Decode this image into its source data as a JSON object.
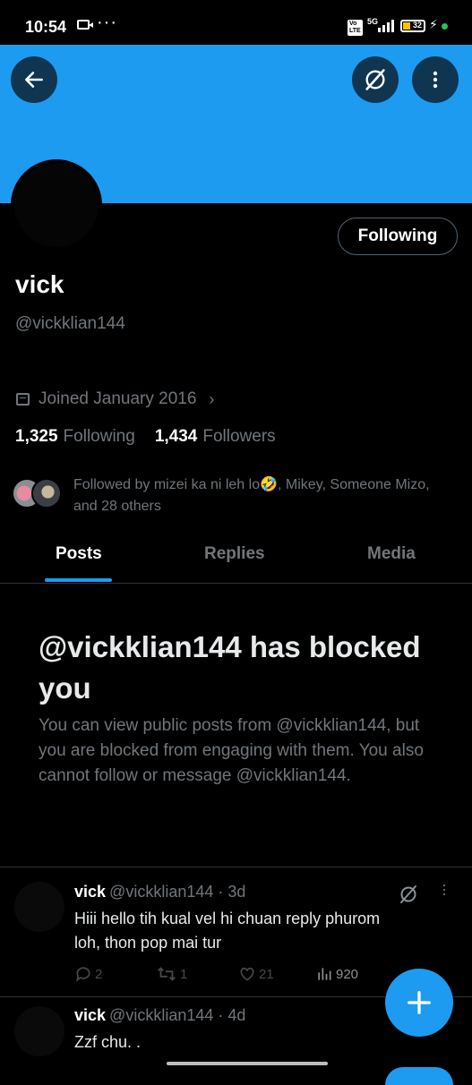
{
  "status_bar": {
    "time": "10:54",
    "network": "5G",
    "volte": "Vo LTE",
    "battery_level": "32",
    "icons": [
      "video-camera-icon",
      "more-dots-icon",
      "signal-icon",
      "battery-icon",
      "charging-bolt-icon"
    ]
  },
  "colors": {
    "accent": "#1d9bf0",
    "background": "#000000",
    "muted_text": "#71767b",
    "primary_text": "#e7e9ea"
  },
  "header": {
    "back_icon": "arrow-left-icon",
    "grok_icon": "grok-icon",
    "more_icon": "more-vertical-icon"
  },
  "profile": {
    "name": "vick",
    "handle": "@vickklian144",
    "following_button": "Following",
    "joined": "Joined January 2016",
    "following_count": "1,325",
    "following_label": "Following",
    "followers_count": "1,434",
    "followers_label": "Followers",
    "followed_by": "Followed by mizei ka ni leh lo🤣, Mikey, Someone Mizo, and 28 others"
  },
  "tabs": [
    {
      "label": "Posts",
      "active": true
    },
    {
      "label": "Replies",
      "active": false
    },
    {
      "label": "Media",
      "active": false
    }
  ],
  "blocked_notice": {
    "title": "@vickklian144 has blocked you",
    "body": "You can view public posts from @vickklian144, but you are blocked from engaging with them. You also cannot follow or message @vickklian144."
  },
  "posts": [
    {
      "name": "vick",
      "meta": "@vickklian144 · 3d",
      "text_line1": "Hiii   hello  tih kual vel hi chuan reply phurom",
      "text_line2": "loh,  thon pop mai tur",
      "replies": "2",
      "reposts": "1",
      "likes": "21",
      "views": "920"
    },
    {
      "name": "vick",
      "meta": "@vickklian144 · 4d",
      "text_line1": "Zzf chu. ."
    }
  ],
  "fab": {
    "icon": "plus-icon"
  }
}
